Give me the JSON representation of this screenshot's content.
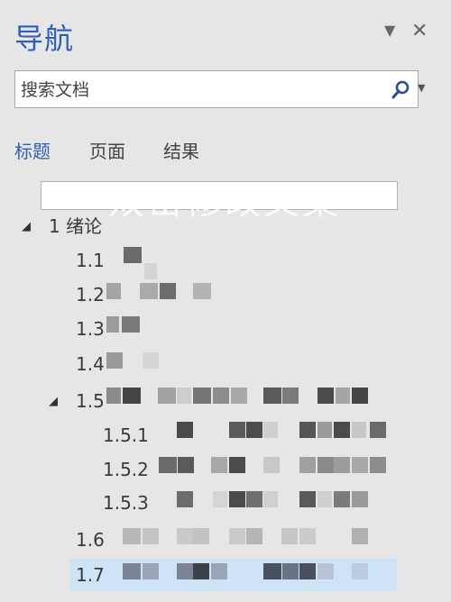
{
  "pane": {
    "title": "导航",
    "pin_icon": "dropdown-triangle-icon",
    "close_label": "✕"
  },
  "search": {
    "placeholder": "搜索文档",
    "icon": "search-icon"
  },
  "tabs": [
    {
      "label": "标题",
      "active": true
    },
    {
      "label": "页面",
      "active": false
    },
    {
      "label": "结果",
      "active": false
    }
  ],
  "watermark": "双击修改文案",
  "headings": [
    {
      "label": "1 绪论",
      "level": 1,
      "expanded": true
    },
    {
      "label": "1.1",
      "level": 2
    },
    {
      "label": "1.2",
      "level": 2
    },
    {
      "label": "1.3",
      "level": 2
    },
    {
      "label": "1.4",
      "level": 2
    },
    {
      "label": "1.5",
      "level": 2,
      "expanded": true
    },
    {
      "label": "1.5.1",
      "level": 3
    },
    {
      "label": "1.5.2",
      "level": 3
    },
    {
      "label": "1.5.3",
      "level": 3
    },
    {
      "label": "1.6",
      "level": 2
    },
    {
      "label": "1.7",
      "level": 2,
      "selected": true
    }
  ],
  "colors": {
    "accent": "#2f5fb3",
    "selection": "#cfe3f7",
    "background": "#e6e6e6"
  }
}
